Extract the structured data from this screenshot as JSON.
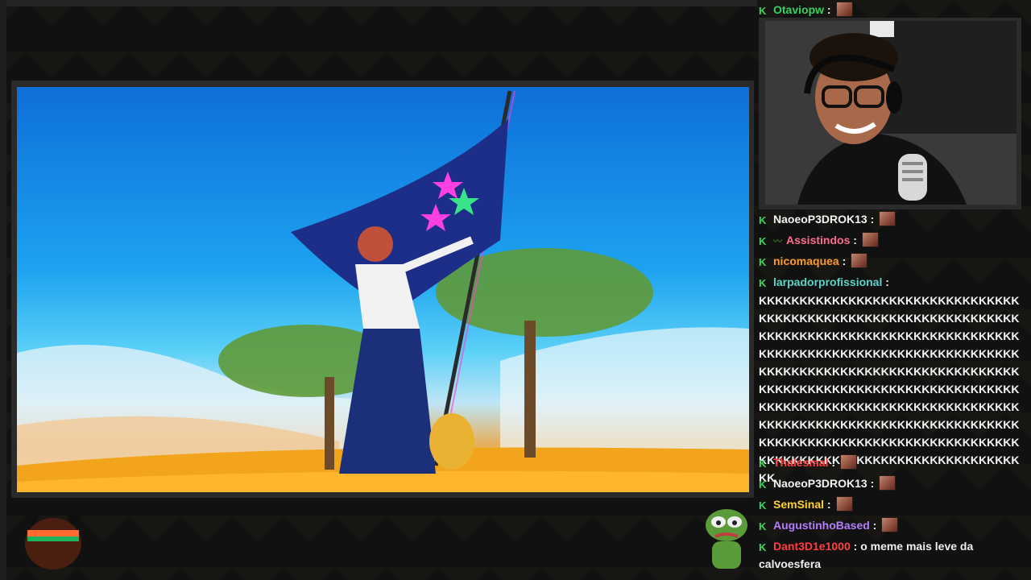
{
  "stream": {
    "video_scene": "flag-bearer-on-hill",
    "streamer_cam": "webcam-feed"
  },
  "chat": {
    "top_message": {
      "user": "Otaviopw",
      "color": "#36d35e"
    },
    "messages": [
      {
        "user": "NaoeoP3DROK13",
        "color": "#f4f4f4",
        "emote": true
      },
      {
        "user": "Assistindos",
        "color": "#ff6b8a",
        "emote": true,
        "extra_badge": true
      },
      {
        "user": "nicomaquea",
        "color": "#ff9a2e",
        "emote": true
      },
      {
        "user": "larpadorprofissional",
        "color": "#5ad5c8",
        "emote": false
      },
      {
        "user": "Thalesmal",
        "color": "#ff3f3f",
        "emote": true
      },
      {
        "user": "NaoeoP3DROK13",
        "color": "#f4f4f4",
        "emote": true
      },
      {
        "user": "SemSinal",
        "color": "#ffcf33",
        "emote": true
      },
      {
        "user": "AugustinhoBased",
        "color": "#b57cff",
        "emote": true
      },
      {
        "user": "Dant3D1e1000",
        "color": "#ff3f3f",
        "emote": false,
        "text": "o meme mais leve da calvoesfera"
      }
    ],
    "spam_text": "KKKKKKKKKKKKKKKKKKKKKKKKKKKKKKKKKKKKKKKKKKKKKKKKKKKKKKKKKKKKKKKKKKKKKKKKKKKKKKKKKKKKKKKKKKKKKKKKKKKKKKKKKKKKKKKKKKKKKKKKKKKKKKKKKKKKKKKKKKKKKKKKKKKKKKKKKKKKKKKKKKKKKKKKKKKKKKKKKKKKKKKKKKKKKKKKKKKKKKKKKKKKKKKKKKKKKKKKKKKKKKKKKKKKKKKKKKKKKKKKKKKKKKKKKKKKKKKKKKKKKKKKKKKKKKKKKKKKKKKKKKKKKKKKKKKKKKKKKKKKKKKKKKKKKKKKKKKKKKKKKK",
    "colon": ":"
  }
}
